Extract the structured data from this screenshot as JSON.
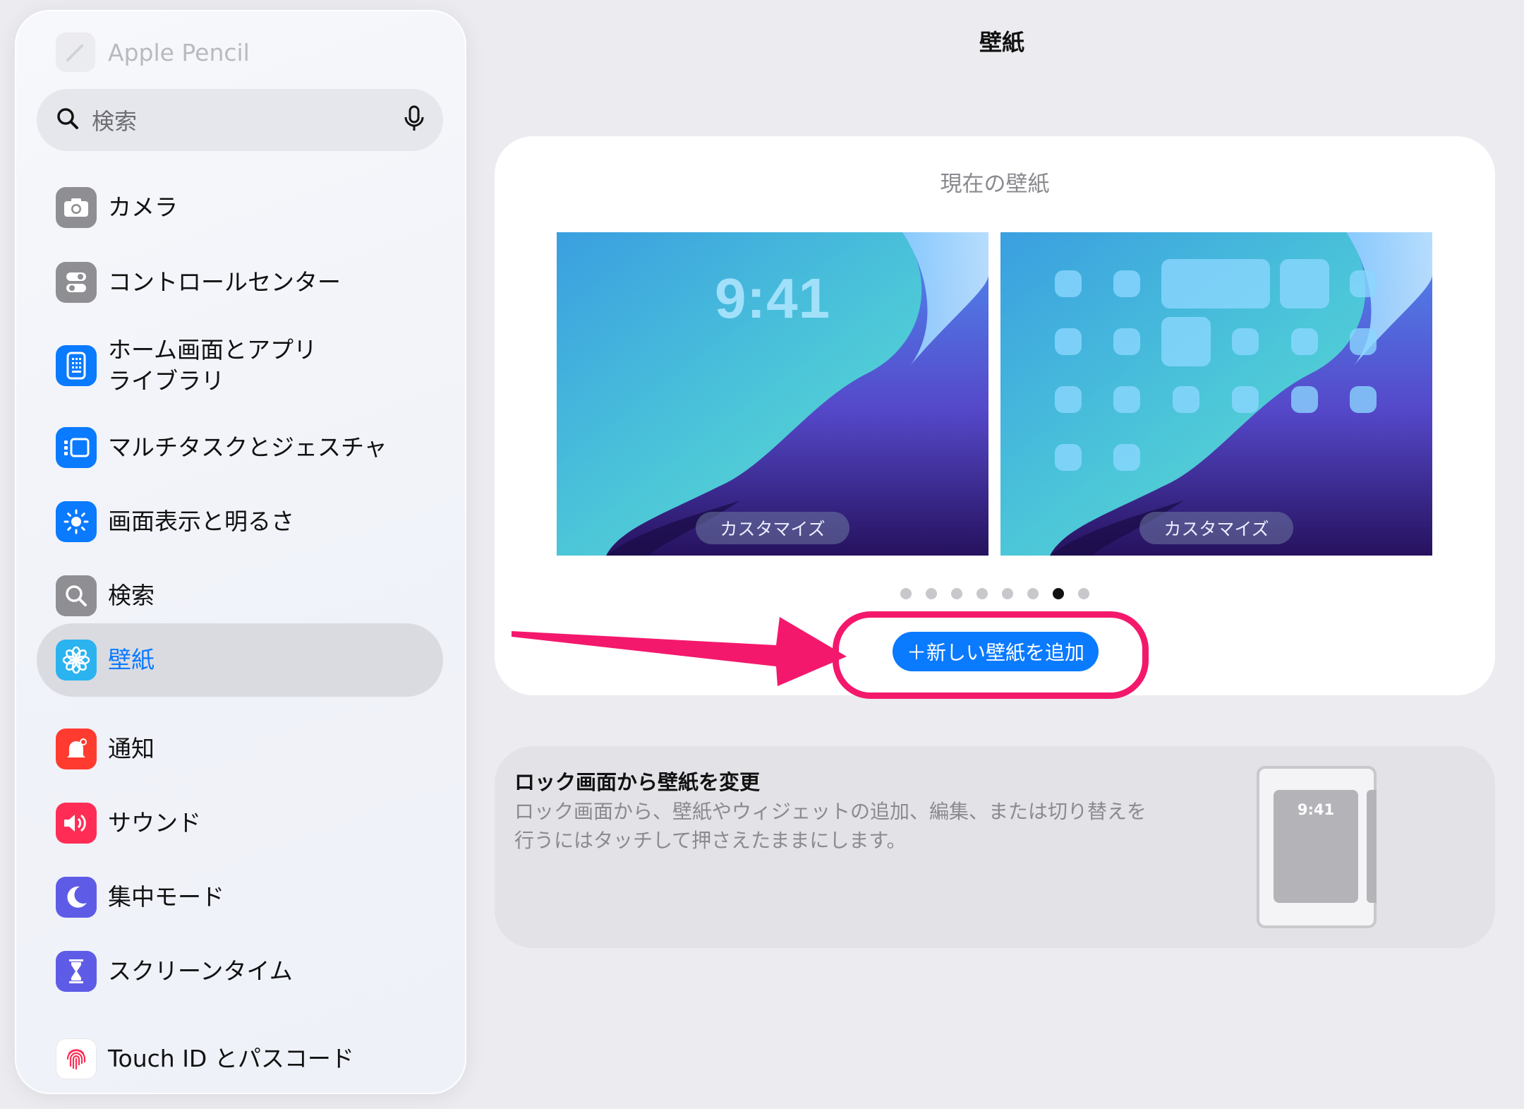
{
  "sidebar": {
    "pencil_label": "Apple Pencil",
    "search_placeholder": "検索",
    "items": [
      {
        "label": "カメラ",
        "icon": "camera-icon",
        "color": "#8e8e93"
      },
      {
        "label": "コントロールセンター",
        "icon": "toggles-icon",
        "color": "#8e8e93"
      },
      {
        "label": "ホーム画面とアプリ\nライブラリ",
        "icon": "home-screen-icon",
        "color": "#0a7aff"
      },
      {
        "label": "マルチタスクとジェスチャ",
        "icon": "multitasking-icon",
        "color": "#0a7aff"
      },
      {
        "label": "画面表示と明るさ",
        "icon": "brightness-icon",
        "color": "#0a7aff"
      },
      {
        "label": "検索",
        "icon": "search-icon",
        "color": "#8e8e93"
      },
      {
        "label": "壁紙",
        "icon": "wallpaper-flower-icon",
        "color": "#2bb3f0",
        "selected": true
      },
      {
        "label": "通知",
        "icon": "notification-bell-icon",
        "color": "#ff3b30"
      },
      {
        "label": "サウンド",
        "icon": "speaker-icon",
        "color": "#ff2d55"
      },
      {
        "label": "集中モード",
        "icon": "moon-icon",
        "color": "#5e5ce6"
      },
      {
        "label": "スクリーンタイム",
        "icon": "hourglass-icon",
        "color": "#5e5ce6"
      },
      {
        "label": "Touch ID とパスコード",
        "icon": "fingerprint-icon",
        "color": "#ff2d55"
      }
    ]
  },
  "main": {
    "page_title": "壁紙",
    "current_wallpaper_title": "現在の壁紙",
    "lock_screen_time": "9:41",
    "customize_label": "カスタマイズ",
    "page_dots": {
      "count": 8,
      "active_index": 6
    },
    "add_button_label": "＋新しい壁紙を追加",
    "info": {
      "title": "ロック画面から壁紙を変更",
      "description": "ロック画面から、壁紙やウィジェットの追加、編集、または切り替えを行うにはタッチして押さえたままにします。",
      "device_time": "9:41"
    }
  },
  "colors": {
    "accent": "#0a7aff",
    "highlight": "#f4186c"
  }
}
